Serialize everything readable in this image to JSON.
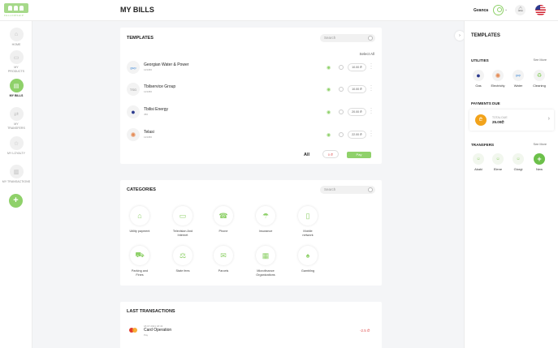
{
  "header": {
    "logo_text": "FELLOWSHIP",
    "page_title": "MY BILLS",
    "user_name": "Gvanca"
  },
  "nav": [
    {
      "label": "HOME",
      "icon": "home-icon"
    },
    {
      "label": "MY PRODUCTS",
      "icon": "wallet-icon"
    },
    {
      "label": "MY BILLS",
      "icon": "bill-icon",
      "active": true
    },
    {
      "label": "MY TRANSFERS",
      "icon": "transfer-icon"
    },
    {
      "label": "MY LOYALTY",
      "icon": "star-icon"
    },
    {
      "label": "MY TRANSACTIONS",
      "icon": "document-icon"
    }
  ],
  "templates": {
    "title": "TEMPLATES",
    "search_placeholder": "Search",
    "select_all": "Select All",
    "rows": [
      {
        "name": "Georgian Water & Power",
        "sub": "123456",
        "amount": "10.00 ₾",
        "logo": "gwp"
      },
      {
        "name": "Tbilservice Group",
        "sub": "123456",
        "amount": "10.00 ₾",
        "logo": "TSG"
      },
      {
        "name": "Tbilisi Energy",
        "sub": "456",
        "amount": "20.00 ₾",
        "logo": "●"
      },
      {
        "name": "Telasi",
        "sub": "123456",
        "amount": "22.00 ₾",
        "logo": "✺"
      }
    ],
    "all_label": "All",
    "total": "0 ₾",
    "pay_label": "Pay"
  },
  "categories": {
    "title": "CATEGORIES",
    "search_placeholder": "Search",
    "items": [
      {
        "label": "Utility payment",
        "icon": "house-icon",
        "glyph": "⌂"
      },
      {
        "label": "Television And Internet",
        "icon": "tv-icon",
        "glyph": "▭"
      },
      {
        "label": "Phone",
        "icon": "phone-icon",
        "glyph": "☎"
      },
      {
        "label": "Insurance",
        "icon": "insurance-icon",
        "glyph": "☂"
      },
      {
        "label": "Mobile network",
        "icon": "mobile-icon",
        "glyph": "▯"
      },
      {
        "label": "Parking and Fines",
        "icon": "car-icon",
        "glyph": "⛟"
      },
      {
        "label": "State fees",
        "icon": "stamp-icon",
        "glyph": "⚖"
      },
      {
        "label": "Parcels",
        "icon": "parcel-icon",
        "glyph": "✉"
      },
      {
        "label": "Microfinance Organizations",
        "icon": "bank-icon",
        "glyph": "▦"
      },
      {
        "label": "Gambling",
        "icon": "cards-icon",
        "glyph": "♠"
      }
    ]
  },
  "last_transactions": {
    "title": "LAST TRANSACTIONS",
    "rows": [
      {
        "date": "18.07.2021 18:43",
        "name": "Card Operation",
        "sub": "Pay",
        "amount": "-2.5 ₾"
      }
    ]
  },
  "right_panel": {
    "title": "TEMPLATES",
    "utilities": {
      "title": "UTILITIES",
      "see_more": "See More",
      "items": [
        {
          "label": "Gas",
          "glyph": "●",
          "color": "#2c3b8f"
        },
        {
          "label": "Electricity",
          "glyph": "✺",
          "color": "#e48b55"
        },
        {
          "label": "Water",
          "glyph": "gwp",
          "color": "#4a8fd8"
        },
        {
          "label": "Cleaning",
          "glyph": "♻",
          "color": "#8fd16a"
        }
      ]
    },
    "payments_due": {
      "title": "PAYMENTS DUE",
      "label": "TOTAL DUE",
      "value": "25.00₾",
      "coin": "₾"
    },
    "transfers": {
      "title": "TRANSFERS",
      "see_more": "See More",
      "items": [
        {
          "label": "Akaki"
        },
        {
          "label": "Elene"
        },
        {
          "label": "Giorgi"
        },
        {
          "label": "New",
          "is_new": true
        }
      ]
    }
  },
  "colors": {
    "accent": "#8fd16a",
    "negative": "#e05252",
    "coin": "#f2a31b"
  }
}
